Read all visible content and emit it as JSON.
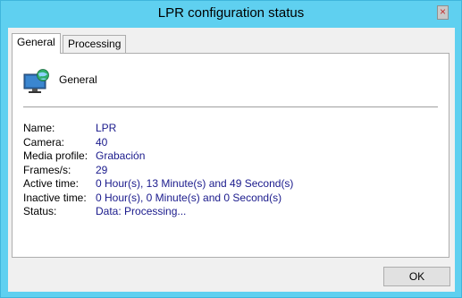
{
  "window": {
    "title": "LPR configuration status",
    "close_glyph": "×"
  },
  "tabs": [
    {
      "label": "General",
      "active": true
    },
    {
      "label": "Processing",
      "active": false
    }
  ],
  "panel": {
    "header_label": "General",
    "icon": "monitor-globe-icon",
    "properties": [
      {
        "label": "Name:",
        "value": "LPR"
      },
      {
        "label": "Camera:",
        "value": "40"
      },
      {
        "label": "Media profile:",
        "value": "Grabación"
      },
      {
        "label": "Frames/s:",
        "value": "29"
      },
      {
        "label": "Active time:",
        "value": "0 Hour(s), 13 Minute(s) and 49 Second(s)"
      },
      {
        "label": "Inactive time:",
        "value": "0 Hour(s), 0 Minute(s) and 0 Second(s)"
      },
      {
        "label": "Status:",
        "value": "Data: Processing..."
      }
    ]
  },
  "buttons": {
    "ok_label": "OK"
  },
  "colors": {
    "titlebar": "#5fd0f0",
    "value_text": "#1a1a8c"
  }
}
